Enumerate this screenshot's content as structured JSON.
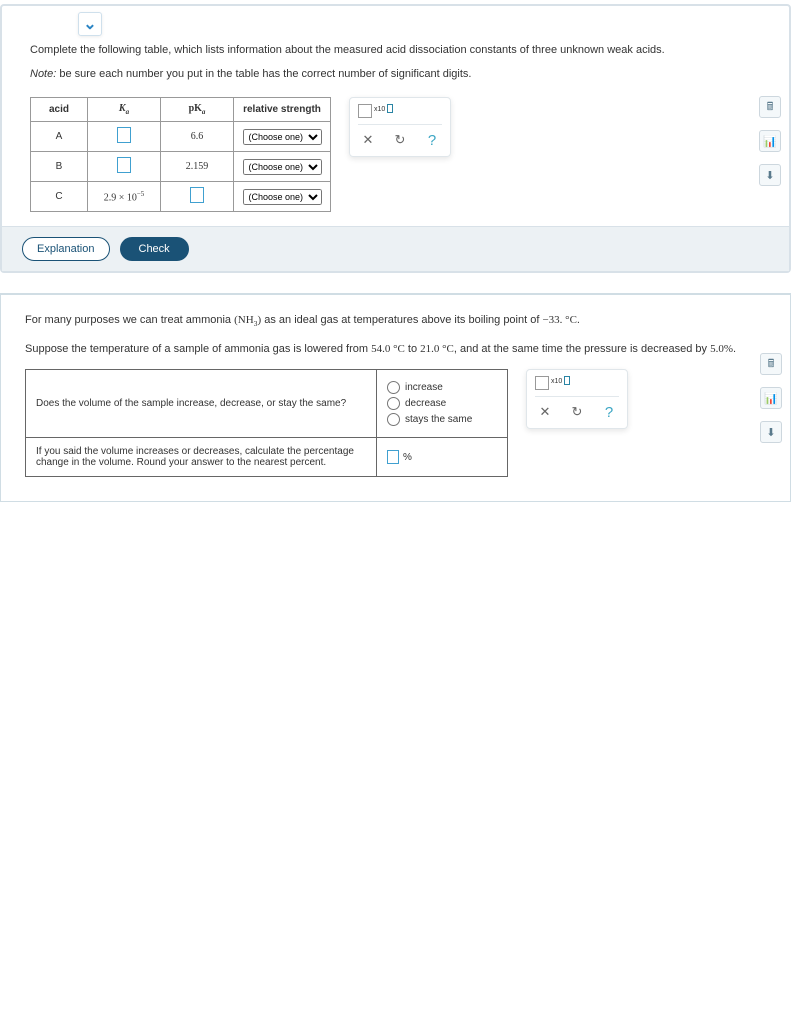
{
  "problem1": {
    "prompt": "Complete the following table, which lists information about the measured acid dissociation constants of three unknown weak acids.",
    "note_prefix": "Note:",
    "note_rest": " be sure each number you put in the table has the correct number of significant digits.",
    "headers": {
      "acid": "acid",
      "ka": "K",
      "ka_sub": "a",
      "pka": "pK",
      "pka_sub": "a",
      "rel": "relative strength"
    },
    "rows": [
      {
        "acid": "A",
        "ka": "",
        "pka": "6.6",
        "rel": "(Choose one)"
      },
      {
        "acid": "B",
        "ka": "",
        "pka": "2.159",
        "rel": "(Choose one)"
      },
      {
        "acid": "C",
        "ka_text": "2.9 × 10",
        "ka_exp": "−5",
        "pka": "",
        "rel": "(Choose one)"
      }
    ],
    "explanation": "Explanation",
    "check": "Check"
  },
  "problem2": {
    "line1_a": "For many purposes we can treat ammonia ",
    "line1_b": "(NH",
    "line1_sub": "3",
    "line1_c": ")",
    "line1_d": " as an ideal gas at temperatures above its boiling point of ",
    "line1_e": "−33. °C",
    "line1_f": ".",
    "line2_a": "Suppose the temperature of a sample of ammonia gas is lowered from ",
    "line2_b": "54.0 °C",
    "line2_c": " to ",
    "line2_d": "21.0 °C",
    "line2_e": ", and at the same time the pressure is decreased by ",
    "line2_f": "5.0%",
    "line2_g": ".",
    "q_row1": "Does the volume of the sample increase, decrease, or stay the same?",
    "opts": {
      "inc": "increase",
      "dec": "decrease",
      "same": "stays the same"
    },
    "q_row2": "If you said the volume increases or decreases, calculate the percentage change in the volume. Round your answer to the nearest percent.",
    "pct": "%",
    "sci_label": "x10"
  },
  "icons": {
    "close": "✕",
    "undo": "↻",
    "help": "?",
    "chev": "⌄",
    "calc": "🖩",
    "bars": "📊",
    "dl": "⬇"
  }
}
